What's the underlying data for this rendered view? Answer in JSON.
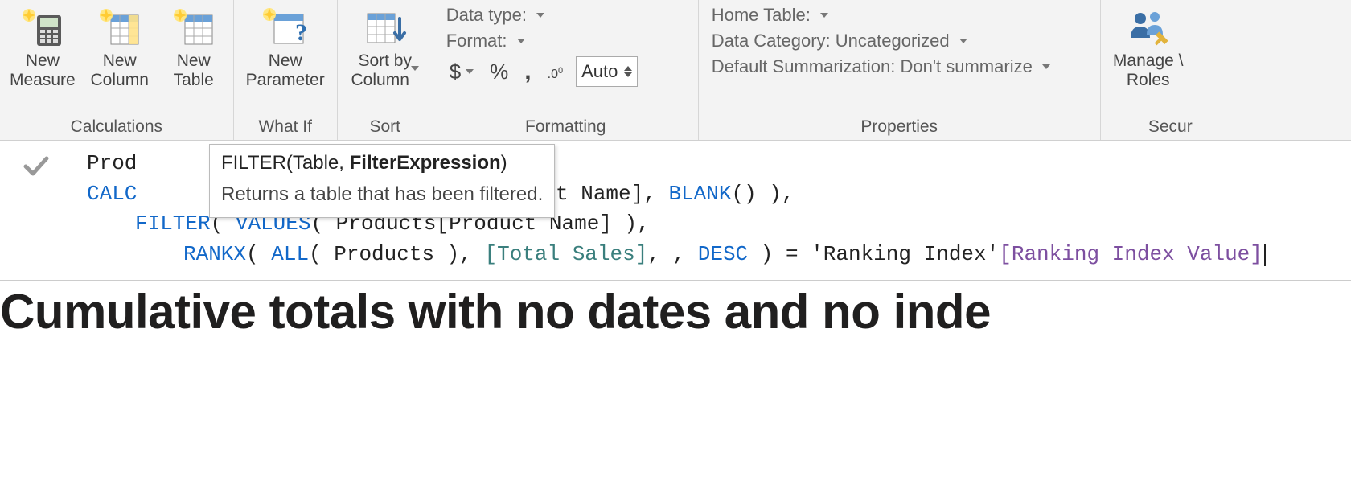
{
  "ribbon": {
    "calculations": {
      "group_name": "Calculations",
      "new_measure": "New\nMeasure",
      "new_column": "New\nColumn",
      "new_table": "New\nTable"
    },
    "whatif": {
      "group_name": "What If",
      "new_parameter": "New\nParameter"
    },
    "sort": {
      "group_name": "Sort",
      "sort_by_column": "Sort by\nColumn"
    },
    "formatting": {
      "group_name": "Formatting",
      "data_type_label": "Data type:",
      "format_label": "Format:",
      "currency_glyph": "$",
      "percent_glyph": "%",
      "thousands_glyph": ",",
      "decimal_glyph": ".00",
      "decimal_box_value": "Auto"
    },
    "properties": {
      "group_name": "Properties",
      "home_table_label": "Home Table:",
      "data_category_label": "Data Category: Uncategorized",
      "default_summarization_label": "Default Summarization: Don't summarize"
    },
    "security": {
      "group_name": "Secur",
      "manage_roles": "Manage \\\nRoles"
    }
  },
  "tooltip": {
    "sig_prefix": "FILTER(",
    "sig_arg1": "Table, ",
    "sig_arg2_bold": "FilterExpression",
    "sig_suffix": ")",
    "description": "Returns a table that has been filtered."
  },
  "formula": {
    "line1_prefix": "Prod",
    "line2_calc": "CALC",
    "line2_mid_black": "ct Name], ",
    "line2_blank": "BLANK",
    "line2_tail": "() ),",
    "line3_filter": "FILTER",
    "line3_p1": "( ",
    "line3_values": "VALUES",
    "line3_p2": "( Products[Product Name] ),",
    "line4_rankx": "RANKX",
    "line4_p1": "( ",
    "line4_all": "ALL",
    "line4_p2": "( Products ), ",
    "line4_total_sales": "[Total Sales]",
    "line4_p3": ", , ",
    "line4_desc": "DESC",
    "line4_p4": " ) = ",
    "line4_table_literal": "'Ranking Index'",
    "line4_col_ref": "[Ranking Index Value]"
  },
  "canvas": {
    "title": "Cumulative totals with no dates and no inde"
  }
}
